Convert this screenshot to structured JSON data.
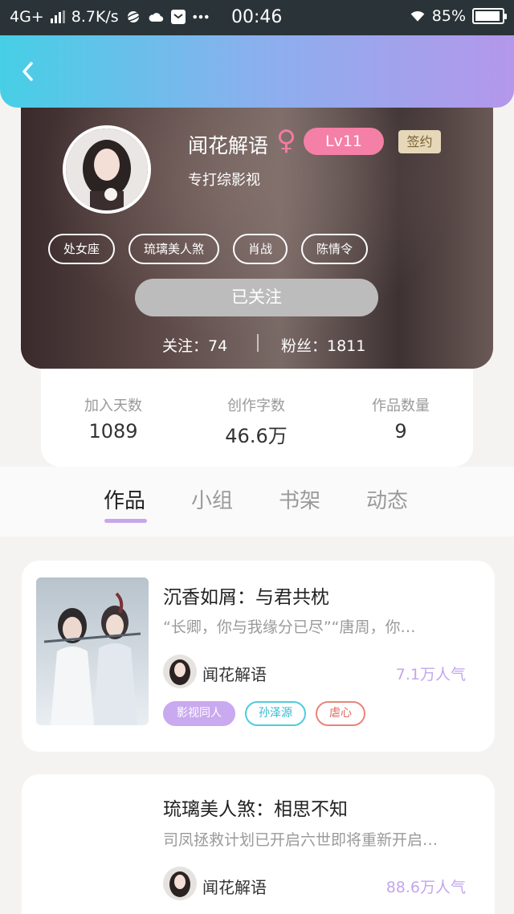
{
  "status_bar": {
    "network": "4G+",
    "speed": "8.7K/s",
    "time": "00:46",
    "battery": "85%",
    "icons": [
      "signal-icon",
      "planet-icon",
      "cloud-icon",
      "mail-icon",
      "more-icon",
      "wifi-icon",
      "battery-icon"
    ]
  },
  "header": {
    "back_icon": "chevron-left-icon"
  },
  "profile": {
    "nickname": "闻花解语",
    "gender_symbol": "♀",
    "level": "Lv11",
    "signed_badge": "签约",
    "bio": "专打综影视",
    "tags": [
      "处女座",
      "琉璃美人煞",
      "肖战",
      "陈情令"
    ],
    "follow_button": "已关注",
    "following": "关注：74",
    "followers": "粉丝：1811"
  },
  "stats": [
    {
      "label": "加入天数",
      "value": "1089"
    },
    {
      "label": "创作字数",
      "value": "46.6万"
    },
    {
      "label": "作品数量",
      "value": "9"
    }
  ],
  "tabs": [
    "作品",
    "小组",
    "书架",
    "动态"
  ],
  "active_tab": "作品",
  "works": [
    {
      "title": "沉香如屑：与君共枕",
      "desc": "“长卿，你与我缘分已尽”“唐周，你…",
      "author": "闻花解语",
      "popularity": "7.1万人气",
      "tags": [
        "影视同人",
        "孙泽源",
        "虐心"
      ]
    },
    {
      "title": "琉璃美人煞：相思不知",
      "desc": "司凤拯救计划已开启六世即将重新开启…",
      "author": "闻花解语",
      "popularity": "88.6万人气"
    }
  ],
  "colors": {
    "accent_purple": "#c3a6ee",
    "level_pink": "#f47fa7",
    "tag_cyan": "#4fcbe0",
    "tag_red": "#e9847a"
  }
}
